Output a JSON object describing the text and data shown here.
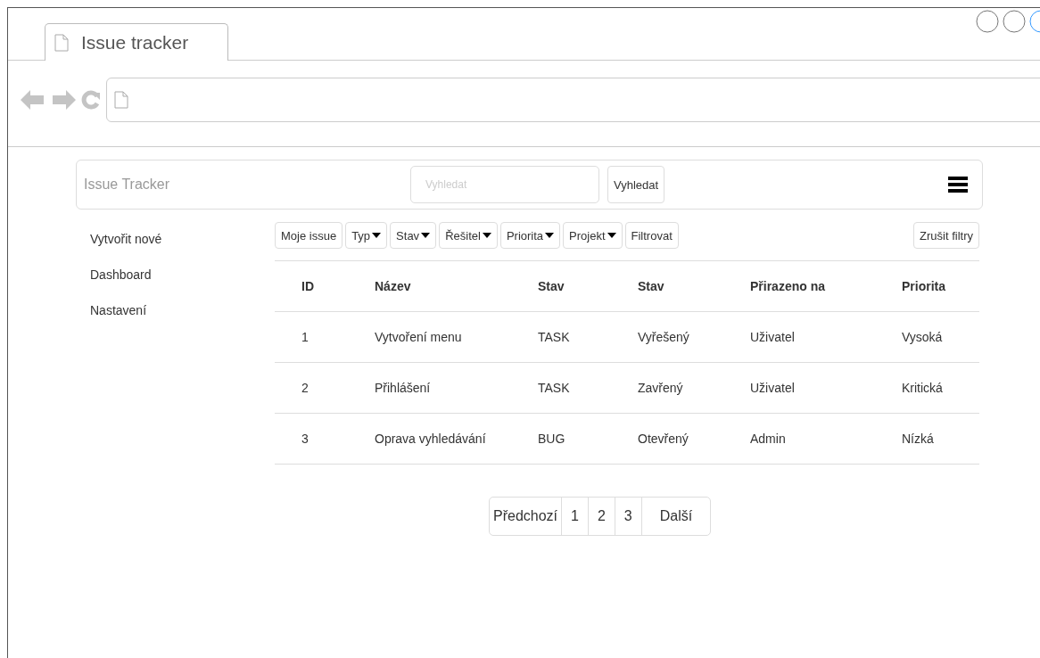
{
  "window": {
    "tab_title": "Issue tracker"
  },
  "header": {
    "brand": "Issue Tracker",
    "search": {
      "placeholder": "Vyhledat"
    },
    "search_button": "Vyhledat"
  },
  "sidebar": {
    "items": [
      "Vytvořit nové",
      "Dashboard",
      "Nastavení"
    ]
  },
  "filters": [
    {
      "label": "Moje issue",
      "kind": "button"
    },
    {
      "label": "Typ",
      "kind": "dropdown"
    },
    {
      "label": "Stav",
      "kind": "dropdown"
    },
    {
      "label": "Řešitel",
      "kind": "dropdown"
    },
    {
      "label": "Priorita",
      "kind": "dropdown"
    },
    {
      "label": "Projekt",
      "kind": "dropdown"
    },
    {
      "label": "Filtrovat",
      "kind": "button"
    }
  ],
  "clear_filters": "Zrušit filtry",
  "table": {
    "columns": [
      "ID",
      "Název",
      "Stav",
      "Stav",
      "Přirazeno na",
      "Priorita"
    ],
    "rows": [
      [
        "1",
        "Vytvoření menu",
        "TASK",
        "Vyřešený",
        "Uživatel",
        "Vysoká"
      ],
      [
        "2",
        "Přihlášení",
        "TASK",
        "Zavřený",
        "Uživatel",
        "Kritická"
      ],
      [
        "3",
        "Oprava vyhledávání",
        "BUG",
        "Otevřený",
        "Admin",
        "Nízká"
      ]
    ]
  },
  "pagination": [
    "Předchozí",
    "1",
    "2",
    "3",
    "Další"
  ]
}
